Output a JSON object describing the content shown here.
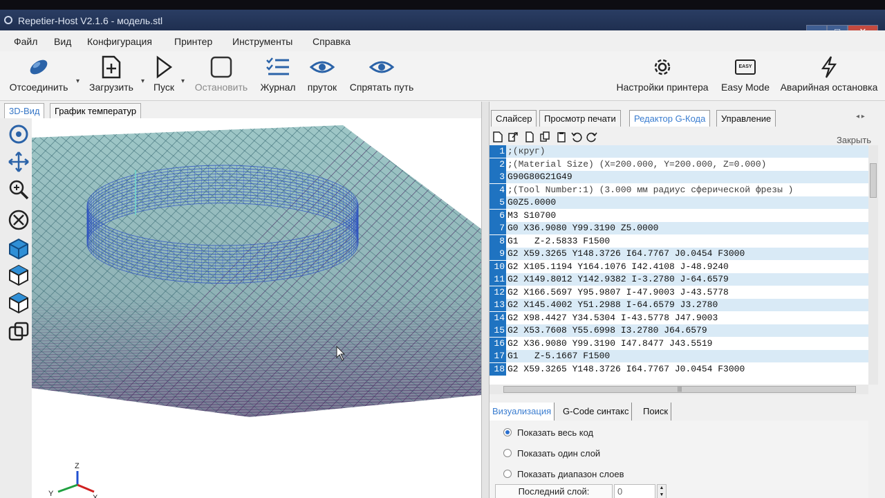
{
  "window": {
    "title": "Repetier-Host V2.1.6 - модель.stl"
  },
  "menu": [
    "Файл",
    "Вид",
    "Конфигурация",
    "Принтер",
    "Инструменты",
    "Справка"
  ],
  "toolbar": {
    "disconnect": "Отсоединить",
    "load": "Загрузить",
    "start": "Пуск",
    "stop": "Остановить",
    "log": "Журнал",
    "filament": "пруток",
    "hide_path": "Спрятать путь",
    "printer_settings": "Настройки принтера",
    "easy_mode": "Easy Mode",
    "emergency": "Аварийная остановка",
    "easy_badge": "EASY"
  },
  "left_tabs": [
    "3D-Вид",
    "График температур"
  ],
  "right_tabs": [
    "Слайсер",
    "Просмотр печати",
    "Редактор G-Кода",
    "Управление"
  ],
  "editor": {
    "close_label": "Закрыть",
    "lines": [
      {
        "n": "1",
        "text": ";(круг)"
      },
      {
        "n": "2",
        "text": ";(Material Size) (X=200.000, Y=200.000, Z=0.000)"
      },
      {
        "n": "3",
        "text": "G90G80G21G49"
      },
      {
        "n": "4",
        "text": ";(Tool Number:1) (3.000 мм радиус сферической фрезы )"
      },
      {
        "n": "5",
        "text": "G0Z5.0000"
      },
      {
        "n": "6",
        "text": "M3 S10700"
      },
      {
        "n": "7",
        "text": "G0 X36.9080 Y99.3190 Z5.0000"
      },
      {
        "n": "8",
        "text": "G1   Z-2.5833 F1500"
      },
      {
        "n": "9",
        "text": "G2 X59.3265 Y148.3726 I64.7767 J0.0454 F3000"
      },
      {
        "n": "10",
        "text": "G2 X105.1194 Y164.1076 I42.4108 J-48.9240"
      },
      {
        "n": "11",
        "text": "G2 X149.8012 Y142.9382 I-3.2780 J-64.6579"
      },
      {
        "n": "12",
        "text": "G2 X166.5697 Y95.9807 I-47.9003 J-43.5778"
      },
      {
        "n": "13",
        "text": "G2 X145.4002 Y51.2988 I-64.6579 J3.2780"
      },
      {
        "n": "14",
        "text": "G2 X98.4427 Y34.5304 I-43.5778 J47.9003"
      },
      {
        "n": "15",
        "text": "G2 X53.7608 Y55.6998 I3.2780 J64.6579"
      },
      {
        "n": "16",
        "text": "G2 X36.9080 Y99.3190 I47.8477 J43.5519"
      },
      {
        "n": "17",
        "text": "G1   Z-5.1667 F1500"
      },
      {
        "n": "18",
        "text": "G2 X59.3265 Y148.3726 I64.7767 J0.0454 F3000"
      }
    ]
  },
  "bottom_tabs": [
    "Визуализация",
    "G-Code синтакс",
    "Поиск"
  ],
  "visualization": {
    "options": [
      "Показать весь код",
      "Показать один слой",
      "Показать диапазон слоев"
    ],
    "selected": 0,
    "last_layer_label": "Последний слой:",
    "last_layer_value": "0"
  },
  "axes": {
    "x": "X",
    "y": "Y",
    "z": "Z"
  },
  "colors": {
    "accent": "#1f73c1",
    "grid_top": "#3f6f78",
    "grid_bottom": "#4a2c63",
    "ring": "#2a4fc0"
  }
}
